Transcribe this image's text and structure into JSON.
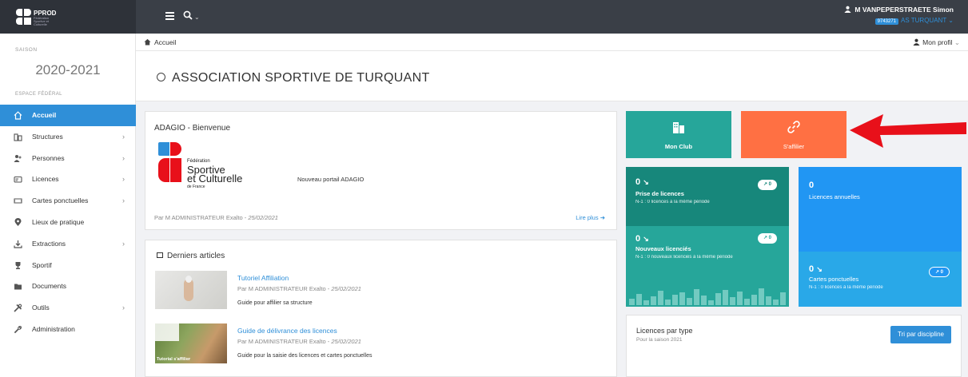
{
  "app": {
    "logo_text": "PPROD",
    "logo_sub": "Fédération Sportive et Culturelle"
  },
  "header": {
    "user_name": "M VANPEPERSTRAETE Simon",
    "user_id": "9743271",
    "club_name": "AS TURQUANT",
    "club_chevron": "⌄",
    "search_chevron": "⌄"
  },
  "sidebar": {
    "season_label": "SAISON",
    "season_value": "2020-2021",
    "espace_label": "ESPACE FÉDÉRAL",
    "items": [
      {
        "label": "Accueil",
        "icon": "home-icon",
        "has_children": false
      },
      {
        "label": "Structures",
        "icon": "building-icon",
        "has_children": true
      },
      {
        "label": "Personnes",
        "icon": "users-icon",
        "has_children": true
      },
      {
        "label": "Licences",
        "icon": "card-icon",
        "has_children": true
      },
      {
        "label": "Cartes ponctuelles",
        "icon": "ticket-icon",
        "has_children": true
      },
      {
        "label": "Lieux de pratique",
        "icon": "map-pin-icon",
        "has_children": false
      },
      {
        "label": "Extractions",
        "icon": "download-icon",
        "has_children": true
      },
      {
        "label": "Sportif",
        "icon": "trophy-icon",
        "has_children": false
      },
      {
        "label": "Documents",
        "icon": "folder-icon",
        "has_children": false
      },
      {
        "label": "Outils",
        "icon": "tools-icon",
        "has_children": true
      },
      {
        "label": "Administration",
        "icon": "wrench-icon",
        "has_children": false
      }
    ]
  },
  "breadcrumb": {
    "home": "Accueil",
    "profile": "Mon profil",
    "profile_chevron": "⌄"
  },
  "page": {
    "title": "ASSOCIATION SPORTIVE DE TURQUANT"
  },
  "welcome": {
    "title": "ADAGIO - Bienvenue",
    "logo_line1": "Fédération",
    "logo_line2": "Sportive",
    "logo_line3": "et Culturelle",
    "logo_line4": "de France",
    "body": "Nouveau portail ADAGIO",
    "author": "Par M ADMINISTRATEUR Exalto - ",
    "date": "25/02/2021",
    "read_more": "Lire plus"
  },
  "articles": {
    "title": "Derniers articles",
    "items": [
      {
        "title": "Tutoriel Affiliation",
        "author": "Par M ADMINISTRATEUR Exalto - ",
        "date": "25/02/2021",
        "summary": "Guide pour affilier sa structure",
        "thumb_caption": ""
      },
      {
        "title": "Guide de délivrance des licences",
        "author": "Par M ADMINISTRATEUR Exalto - ",
        "date": "25/02/2021",
        "summary": "Guide pour la saisie des licences et cartes ponctuelles",
        "thumb_caption": "Tutorial s'affilier"
      }
    ]
  },
  "tiles": {
    "club": {
      "label": "Mon Club",
      "color": "#26a69a"
    },
    "affilier": {
      "label": "S'affilier",
      "color": "#ff7043"
    }
  },
  "stats": {
    "licences_prise": {
      "value": "0",
      "label": "Prise de licences",
      "sub": "N-1 : 0 licences à la même période",
      "badge": "0"
    },
    "nouveaux": {
      "value": "0",
      "label": "Nouveaux licenciés",
      "sub": "N-1 : 0 nouveaux licenciés à la même période",
      "badge": "0"
    },
    "annuelles": {
      "value": "0",
      "label": "Licences annuelles"
    },
    "ponctuelles": {
      "value": "0",
      "label": "Cartes ponctuelles",
      "sub": "N-1 : 0 licences à la même période",
      "badge": "0"
    }
  },
  "licences_type": {
    "title": "Licences par type",
    "sub": "Pour la saison 2021",
    "button": "Tri par discipline"
  },
  "colors": {
    "accent": "#2f8fd8",
    "teal": "#26a69a",
    "teal_dark": "#17877b",
    "orange": "#ff7043",
    "sky": "#29a8e8",
    "arrow": "#e8101a"
  }
}
